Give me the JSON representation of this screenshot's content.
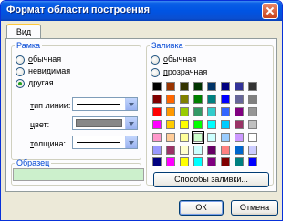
{
  "window": {
    "title": "Формат области построения"
  },
  "tabs": [
    {
      "label": "Вид"
    }
  ],
  "border_group": {
    "legend": "Рамка",
    "options": [
      {
        "label": "обычная",
        "selected": false
      },
      {
        "label": "невидимая",
        "selected": false
      },
      {
        "label": "другая",
        "selected": true
      }
    ],
    "line_type_label": "тип линии:",
    "color_label": "цвет:",
    "thickness_label": "толщина:",
    "color_value": "#888888"
  },
  "fill_group": {
    "legend": "Заливка",
    "options": [
      {
        "label": "обычная",
        "selected": false
      },
      {
        "label": "прозрачная",
        "selected": false
      }
    ],
    "fill_effects_button": "Способы заливки...",
    "palette_rows": [
      [
        "#000000",
        "#993300",
        "#333300",
        "#003300",
        "#003366",
        "#000080",
        "#333399",
        "#333333"
      ],
      [
        "#800000",
        "#ff6600",
        "#808000",
        "#008000",
        "#008080",
        "#0000ff",
        "#666699",
        "#808080"
      ],
      [
        "#ff0000",
        "#ff9900",
        "#99cc00",
        "#339966",
        "#33cccc",
        "#3366ff",
        "#800080",
        "#969696"
      ],
      [
        "#ff00ff",
        "#ffcc00",
        "#ffff00",
        "#00ff00",
        "#00ffff",
        "#00ccff",
        "#993366",
        "#c0c0c0"
      ],
      [
        "#ff99cc",
        "#ffcc99",
        "#ffff99",
        "#ccffcc",
        "#ccffff",
        "#99ccff",
        "#cc99ff",
        "#ffffff"
      ]
    ],
    "palette_extra_rows": [
      [
        "#9999ff",
        "#993366",
        "#ffffcc",
        "#ccffff",
        "#660066",
        "#ff8080",
        "#0066cc",
        "#ccccff"
      ],
      [
        "#000080",
        "#ff00ff",
        "#ffff00",
        "#00ffff",
        "#800080",
        "#800000",
        "#008080",
        "#0000ff"
      ]
    ]
  },
  "sample_group": {
    "legend": "Образец",
    "fill_color": "#ccf0cc"
  },
  "footer": {
    "ok_label": "ОК",
    "cancel_label": "Отмена"
  }
}
